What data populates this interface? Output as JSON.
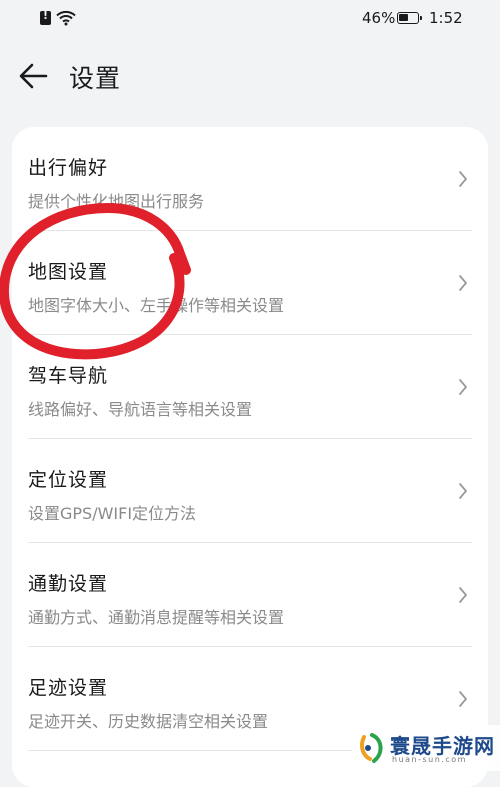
{
  "status_bar": {
    "battery_percent": "46%",
    "time": "1:52",
    "icons": [
      "sim-alert-icon",
      "wifi-icon",
      "battery-icon"
    ]
  },
  "header": {
    "back_icon": "arrow-left-icon",
    "title": "设置"
  },
  "settings_list": [
    {
      "title": "出行偏好",
      "subtitle": "提供个性化地图出行服务"
    },
    {
      "title": "地图设置",
      "subtitle": "地图字体大小、左手操作等相关设置"
    },
    {
      "title": "驾车导航",
      "subtitle": "线路偏好、导航语言等相关设置"
    },
    {
      "title": "定位设置",
      "subtitle": "设置GPS/WIFI定位方法"
    },
    {
      "title": "通勤设置",
      "subtitle": "通勤方式、通勤消息提醒等相关设置"
    },
    {
      "title": "足迹设置",
      "subtitle": "足迹开关、历史数据清空相关设置"
    }
  ],
  "annotation": {
    "highlight_color": "#e0202a",
    "highlighted_item": "地图设置"
  },
  "watermark": {
    "text": "寰晟手游网",
    "url": "huan-sun.com"
  },
  "colors": {
    "background": "#f1f3f5",
    "card": "#ffffff",
    "subtitle": "#8a8a8a",
    "watermark": "#1e4a8c"
  }
}
